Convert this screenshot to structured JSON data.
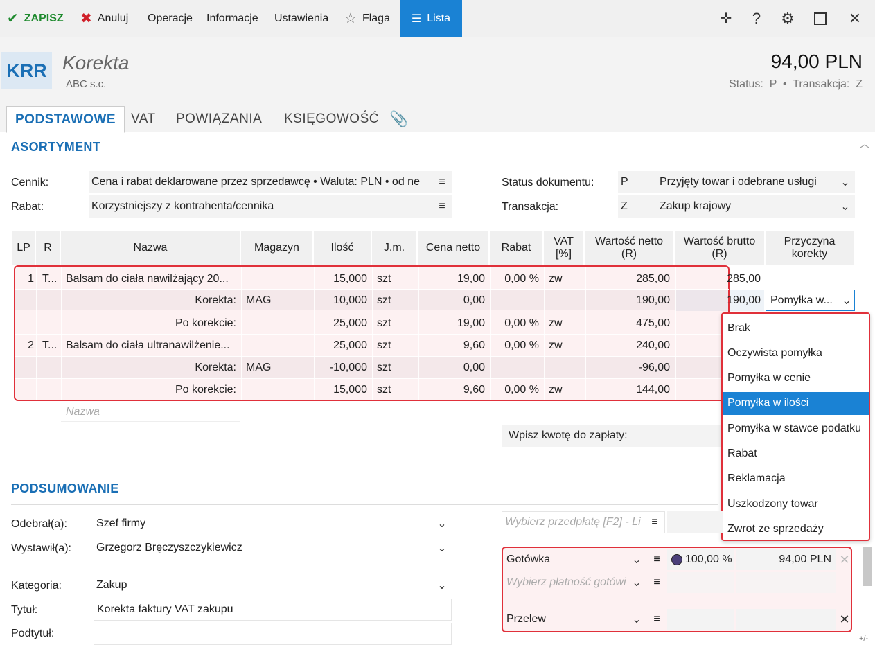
{
  "toolbar": {
    "save": "ZAPISZ",
    "cancel": "Anuluj",
    "operations": "Operacje",
    "information": "Informacje",
    "settings": "Ustawienia",
    "flag": "Flaga",
    "list": "Lista"
  },
  "header": {
    "badge": "KRR",
    "title": "Korekta",
    "subtitle": "ABC s.c.",
    "amount": "94,00 PLN",
    "status": "Status:  P  •  Transakcja:  Z"
  },
  "tabs": [
    "PODSTAWOWE",
    "VAT",
    "POWIĄZANIA",
    "KSIĘGOWOŚĆ"
  ],
  "assortment": {
    "title": "ASORTYMENT",
    "price_list_label": "Cennik:",
    "price_list_value": "Cena i rabat deklarowane przez sprzedawcę • Waluta: PLN • od ne",
    "discount_label": "Rabat:",
    "discount_value": "Korzystniejszy z kontrahenta/cennika",
    "doc_status_label": "Status dokumentu:",
    "doc_status_code": "P",
    "doc_status_value": "Przyjęty towar i odebrane usługi",
    "transaction_label": "Transakcja:",
    "transaction_code": "Z",
    "transaction_value": "Zakup krajowy"
  },
  "table": {
    "headers": {
      "lp": "LP",
      "r": "R",
      "name": "Nazwa",
      "warehouse": "Magazyn",
      "qty": "Ilość",
      "unit": "J.m.",
      "net_price": "Cena netto",
      "discount": "Rabat",
      "vat": "VAT [%]",
      "net_value": "Wartość netto (R)",
      "gross_value": "Wartość brutto (R)",
      "reason": "Przyczyna korekty"
    },
    "rows": [
      {
        "lp": "1",
        "r": "T...",
        "name": "Balsam do ciała nawilżający 20...",
        "warehouse": "",
        "qty": "15,000",
        "unit": "szt",
        "net_price": "19,00",
        "discount": "0,00 %",
        "vat": "zw",
        "net_value": "285,00",
        "gross_value": "285,00"
      },
      {
        "lp": "",
        "r": "",
        "name": "Korekta:",
        "warehouse": "MAG",
        "qty": "10,000",
        "unit": "szt",
        "net_price": "0,00",
        "discount": "",
        "vat": "",
        "net_value": "190,00",
        "gross_value": "190,00",
        "reason": "Pomyłka w..."
      },
      {
        "lp": "",
        "r": "",
        "name": "Po korekcie:",
        "warehouse": "",
        "qty": "25,000",
        "unit": "szt",
        "net_price": "19,00",
        "discount": "0,00 %",
        "vat": "zw",
        "net_value": "475,00",
        "gross_value": ""
      },
      {
        "lp": "2",
        "r": "T...",
        "name": "Balsam do ciała ultranawilżenie...",
        "warehouse": "",
        "qty": "25,000",
        "unit": "szt",
        "net_price": "9,60",
        "discount": "0,00 %",
        "vat": "zw",
        "net_value": "240,00",
        "gross_value": ""
      },
      {
        "lp": "",
        "r": "",
        "name": "Korekta:",
        "warehouse": "MAG",
        "qty": "-10,000",
        "unit": "szt",
        "net_price": "0,00",
        "discount": "",
        "vat": "",
        "net_value": "-96,00",
        "gross_value": ""
      },
      {
        "lp": "",
        "r": "",
        "name": "Po korekcie:",
        "warehouse": "",
        "qty": "15,000",
        "unit": "szt",
        "net_price": "9,60",
        "discount": "0,00 %",
        "vat": "zw",
        "net_value": "144,00",
        "gross_value": ""
      }
    ],
    "new_row_placeholder": "Nazwa"
  },
  "reason_dropdown": {
    "options": [
      "Brak",
      "Oczywista pomyłka",
      "Pomyłka w cenie",
      "Pomyłka w ilości",
      "Pomyłka w stawce podatku",
      "Rabat",
      "Reklamacja",
      "Uszkodzony towar",
      "Zwrot ze sprzedaży"
    ],
    "selected_index": 3
  },
  "payment_amount_label": "Wpisz kwotę do zapłaty:",
  "summary": {
    "title": "PODSUMOWANIE",
    "received_label": "Odebrał(a):",
    "received_value": "Szef firmy",
    "issued_label": "Wystawił(a):",
    "issued_value": "Grzegorz Bręczyszczykiewicz",
    "category_label": "Kategoria:",
    "category_value": "Zakup",
    "title_label": "Tytuł:",
    "title_value": "Korekta faktury VAT zakupu",
    "subtitle_label": "Podtytuł:",
    "subtitle_value": ""
  },
  "payments": {
    "prepayment_placeholder": "Wybierz przedpłatę [F2] - Li",
    "cash_label": "Gotówka",
    "cash_percent": "100,00 %",
    "cash_amount": "94,00 PLN",
    "cash_select_placeholder": "Wybierz płatność gotówi",
    "transfer_label": "Przelew"
  },
  "footer_hint": "+/-"
}
